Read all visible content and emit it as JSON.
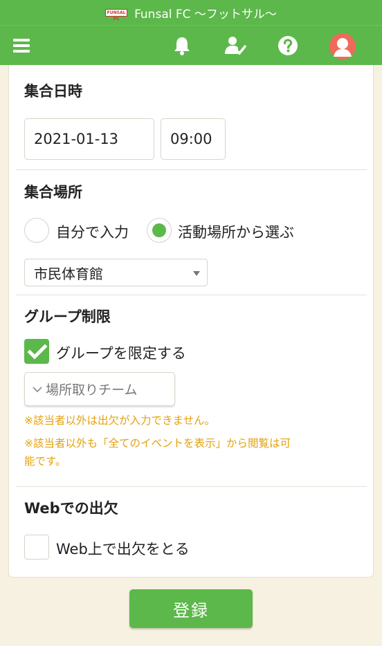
{
  "header": {
    "logo_text": "FUNSAL FC",
    "title": "Funsal FC 〜フットサル〜"
  },
  "toolbar": {
    "menu_icon": "hamburger-icon",
    "notification_icon": "bell-icon",
    "attendance_icon": "user-check-icon",
    "help_icon": "question-icon",
    "avatar_icon": "avatar-icon"
  },
  "meeting_datetime": {
    "title": "集合日時",
    "date": "2021-01-13",
    "time": "09:00"
  },
  "meeting_place": {
    "title": "集合場所",
    "options": [
      {
        "label": "自分で入力",
        "selected": false
      },
      {
        "label": "活動場所から選ぶ",
        "selected": true
      }
    ],
    "place_select": "市民体育館"
  },
  "group_limit": {
    "title": "グループ制限",
    "checkbox_label": "グループを限定する",
    "checked": true,
    "group_select": "場所取りチーム",
    "notes": [
      "※該当者以外は出欠が入力できません。",
      "※該当者以外も「全てのイベントを表示」から閲覧は可",
      "能です。"
    ]
  },
  "web_attendance": {
    "title": "Webでの出欠",
    "checkbox_label": "Web上で出欠をとる",
    "checked": false
  },
  "submit": {
    "label": "登録"
  },
  "colors": {
    "brand_green": "#5cb84a",
    "note_orange": "#e4a20e",
    "background": "#f7f1e1",
    "avatar_red": "#f06a5a"
  }
}
